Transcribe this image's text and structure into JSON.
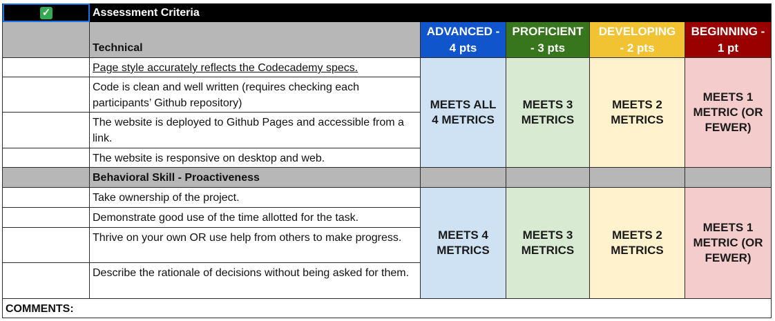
{
  "title_row": {
    "check_icon": "check-mark-icon",
    "title": "Assessment Criteria"
  },
  "levels": [
    {
      "line1": "ADVANCED -",
      "line2": "4 pts",
      "color": "#1155cc"
    },
    {
      "line1": "PROFICIENT",
      "line2": "- 3 pts",
      "color": "#38761d"
    },
    {
      "line1": "DEVELOPING",
      "line2": "- 2 pts",
      "color": "#f1c232"
    },
    {
      "line1": "BEGINNING -",
      "line2": "1 pt",
      "color": "#990000"
    }
  ],
  "sections": [
    {
      "heading": "Technical",
      "criteria": [
        "Page style accurately reflects the Codecademy specs.",
        "Code is clean and well written (requires checking each participants’ Github repository)",
        "The website is deployed to Github Pages and accessible from a link.",
        "The website is responsive on desktop and web."
      ],
      "levels": [
        "MEETS ALL 4 METRICS",
        "MEETS 3 METRICS",
        "MEETS 2 METRICS",
        "MEETS 1 METRIC (OR FEWER)"
      ]
    },
    {
      "heading": "Behavioral Skill - Proactiveness",
      "criteria": [
        "Take ownership of the project.",
        "Demonstrate good use of the time allotted for the task.",
        "Thrive on your own OR use help from others to make progress.",
        "Describe the rationale of decisions without being asked for them."
      ],
      "levels": [
        "MEETS 4 METRICS",
        "MEETS 3 METRICS",
        "MEETS 2 METRICS",
        "MEETS 1 METRIC (OR FEWER)"
      ]
    }
  ],
  "comments_label": "COMMENTS:",
  "colors": {
    "header_black": "#000000",
    "section_gray": "#b7b7b7",
    "selected_cell": "#1a73e8",
    "advanced_fill": "#cfe2f3",
    "proficient_fill": "#d9ead3",
    "developing_fill": "#fff2cc",
    "beginning_fill": "#f4cccc"
  }
}
